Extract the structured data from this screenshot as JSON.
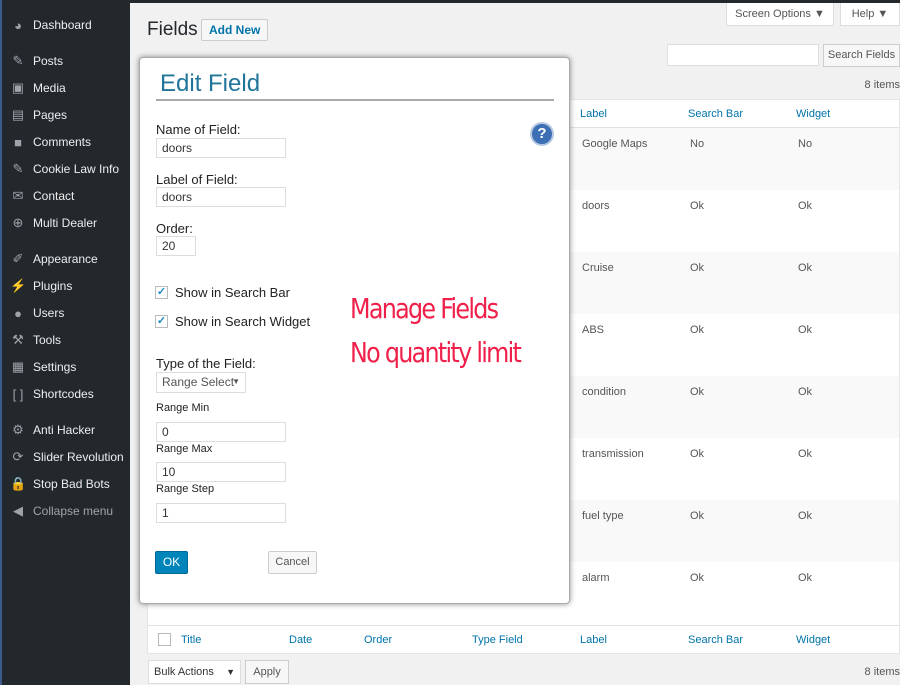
{
  "sidebar": {
    "items": [
      {
        "label": "Dashboard",
        "icon": "dashboard-icon",
        "glyph": "◕"
      },
      {
        "label": "Posts",
        "icon": "pin-icon",
        "glyph": "✎"
      },
      {
        "label": "Media",
        "icon": "media-icon",
        "glyph": "▣"
      },
      {
        "label": "Pages",
        "icon": "pages-icon",
        "glyph": "▤"
      },
      {
        "label": "Comments",
        "icon": "comment-icon",
        "glyph": "■"
      },
      {
        "label": "Cookie Law Info",
        "icon": "pin-icon",
        "glyph": "✎"
      },
      {
        "label": "Contact",
        "icon": "mail-icon",
        "glyph": "✉"
      },
      {
        "label": "Multi Dealer",
        "icon": "globe-icon",
        "glyph": "⊕"
      },
      {
        "label": "Appearance",
        "icon": "brush-icon",
        "glyph": "✐"
      },
      {
        "label": "Plugins",
        "icon": "plugin-icon",
        "glyph": "⚡"
      },
      {
        "label": "Users",
        "icon": "users-icon",
        "glyph": "●"
      },
      {
        "label": "Tools",
        "icon": "wrench-icon",
        "glyph": "⚒"
      },
      {
        "label": "Settings",
        "icon": "settings-icon",
        "glyph": "▦"
      },
      {
        "label": "Shortcodes",
        "icon": "brackets-icon",
        "glyph": "[ ]"
      },
      {
        "label": "Anti Hacker",
        "icon": "gear-icon",
        "glyph": "⚙"
      },
      {
        "label": "Slider Revolution",
        "icon": "refresh-icon",
        "glyph": "⟳"
      },
      {
        "label": "Stop Bad Bots",
        "icon": "lock-icon",
        "glyph": "🔒"
      },
      {
        "label": "Collapse menu",
        "icon": "collapse-icon",
        "glyph": "◀"
      }
    ]
  },
  "header": {
    "title": "Fields",
    "add_new": "Add New",
    "screen_options": "Screen Options ▼",
    "help": "Help ▼",
    "search_button": "Search Fields",
    "search_value": "",
    "items_count": "8 items"
  },
  "table": {
    "columns": [
      "Title",
      "Date",
      "Order",
      "Type Field",
      "Label",
      "Search Bar",
      "Widget"
    ],
    "rows": [
      {
        "label": "Google Maps",
        "search_bar": "No",
        "widget": "No"
      },
      {
        "label": "doors",
        "search_bar": "Ok",
        "widget": "Ok"
      },
      {
        "label": "Cruise",
        "search_bar": "Ok",
        "widget": "Ok"
      },
      {
        "label": "ABS",
        "search_bar": "Ok",
        "widget": "Ok"
      },
      {
        "label": "condition",
        "search_bar": "Ok",
        "widget": "Ok"
      },
      {
        "label": "transmission",
        "search_bar": "Ok",
        "widget": "Ok"
      },
      {
        "label": "fuel type",
        "search_bar": "Ok",
        "widget": "Ok"
      },
      {
        "label": "alarm",
        "search_bar": "Ok",
        "widget": "Ok"
      }
    ]
  },
  "footer": {
    "bulk_actions": "Bulk Actions",
    "apply": "Apply",
    "items_count": "8 items"
  },
  "modal": {
    "title": "Edit Field",
    "name_label": "Name of Field:",
    "name_value": "doors",
    "label_label": "Label of Field:",
    "label_value": "doors",
    "order_label": "Order:",
    "order_value": "20",
    "show_search_bar": "Show in Search Bar",
    "show_search_bar_checked": true,
    "show_search_widget": "Show in Search Widget",
    "show_search_widget_checked": true,
    "type_label": "Type of the Field:",
    "type_value": "Range Select",
    "range_min_label": "Range Min",
    "range_min": "0",
    "range_max_label": "Range Max",
    "range_max": "10",
    "range_step_label": "Range Step",
    "range_step": "1",
    "ok": "OK",
    "cancel": "Cancel",
    "help_glyph": "?"
  },
  "promo": {
    "line1": "Manage Fields",
    "line2": "No quantity limit",
    "color": "#f0204a"
  }
}
